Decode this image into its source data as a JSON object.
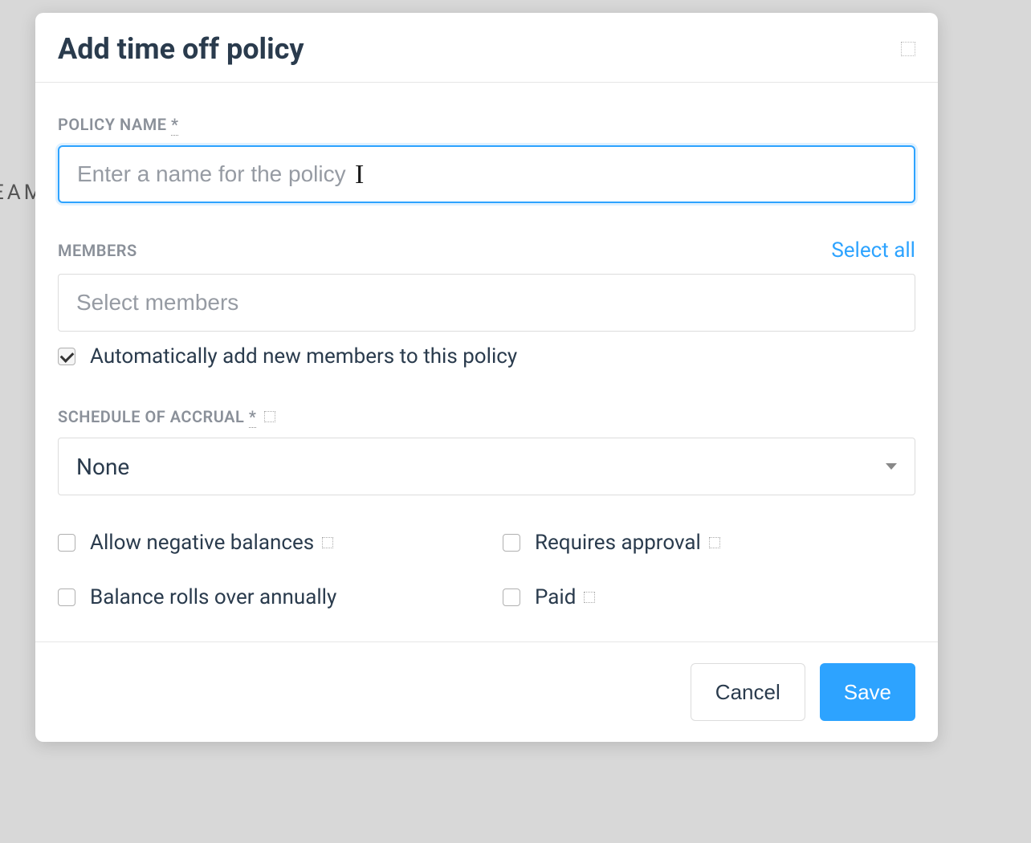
{
  "backdrop": {
    "text_fragment": "EAM"
  },
  "modal": {
    "title": "Add time off policy",
    "policy_name": {
      "label": "POLICY NAME",
      "required_mark": "*",
      "placeholder": "Enter a name for the policy",
      "value": ""
    },
    "members": {
      "label": "MEMBERS",
      "select_all": "Select all",
      "placeholder": "Select members",
      "auto_add_label": "Automatically add new members to this policy",
      "auto_add_checked": true
    },
    "schedule": {
      "label": "SCHEDULE OF ACCRUAL",
      "required_mark": "*",
      "selected": "None"
    },
    "options": {
      "allow_negative": {
        "label": "Allow negative balances",
        "checked": false
      },
      "requires_approval": {
        "label": "Requires approval",
        "checked": false
      },
      "rolls_over": {
        "label": "Balance rolls over annually",
        "checked": false
      },
      "paid": {
        "label": "Paid",
        "checked": false
      }
    },
    "footer": {
      "cancel": "Cancel",
      "save": "Save"
    }
  }
}
